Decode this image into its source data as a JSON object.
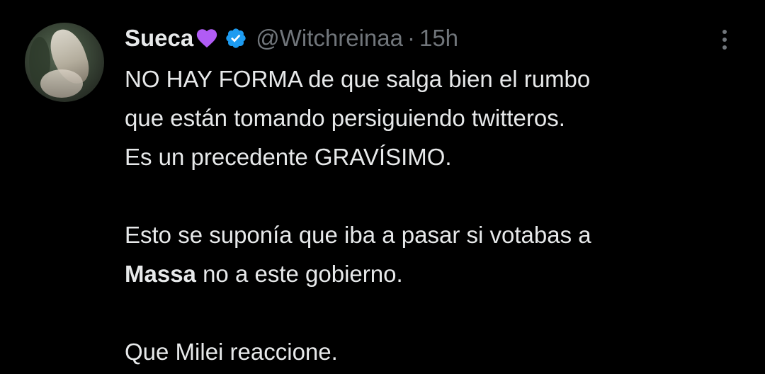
{
  "tweet": {
    "author": {
      "name": "Sueca",
      "emoji": "purple-heart-icon",
      "verified": true,
      "handle": "@Witchreinaa",
      "separator": "·",
      "time": "15h"
    },
    "text": {
      "line1": "NO HAY FORMA de que salga bien el rumbo",
      "line2": "que están tomando persiguiendo twitteros.",
      "line3": "Es un precedente GRAVÍSIMO.",
      "line4": "Esto se suponía que iba a pasar si votabas a",
      "line5_bold": "Massa",
      "line5_rest": " no a este gobierno.",
      "line6": "Que Milei reaccione."
    },
    "colors": {
      "background": "#000000",
      "text": "#e7e9ea",
      "secondary": "#71767b",
      "verified": "#1d9bf0",
      "heart": "#a855f7"
    }
  }
}
